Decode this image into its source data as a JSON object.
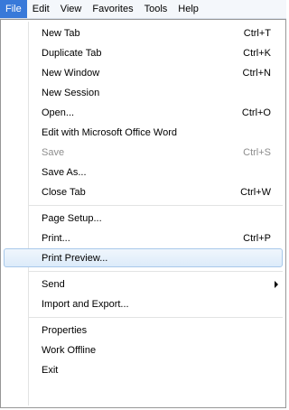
{
  "menubar": {
    "items": [
      {
        "label": "File",
        "active": true
      },
      {
        "label": "Edit"
      },
      {
        "label": "View"
      },
      {
        "label": "Favorites"
      },
      {
        "label": "Tools"
      },
      {
        "label": "Help"
      }
    ]
  },
  "menu": {
    "items": [
      {
        "label": "New Tab",
        "shortcut": "Ctrl+T"
      },
      {
        "label": "Duplicate Tab",
        "shortcut": "Ctrl+K"
      },
      {
        "label": "New Window",
        "shortcut": "Ctrl+N"
      },
      {
        "label": "New Session",
        "shortcut": ""
      },
      {
        "label": "Open...",
        "shortcut": "Ctrl+O"
      },
      {
        "label": "Edit with Microsoft Office Word",
        "shortcut": ""
      },
      {
        "label": "Save",
        "shortcut": "Ctrl+S",
        "disabled": true
      },
      {
        "label": "Save As...",
        "shortcut": ""
      },
      {
        "label": "Close Tab",
        "shortcut": "Ctrl+W"
      },
      {
        "label": "Page Setup...",
        "shortcut": ""
      },
      {
        "label": "Print...",
        "shortcut": "Ctrl+P"
      },
      {
        "label": "Print Preview...",
        "shortcut": "",
        "highlighted": true
      },
      {
        "label": "Send",
        "shortcut": "",
        "submenu": true
      },
      {
        "label": "Import and Export...",
        "shortcut": ""
      },
      {
        "label": "Properties",
        "shortcut": ""
      },
      {
        "label": "Work Offline",
        "shortcut": ""
      },
      {
        "label": "Exit",
        "shortcut": ""
      }
    ]
  },
  "colors": {
    "active_menubar_bg": "#3879d9",
    "hover_border": "#a8c8ea",
    "disabled_text": "#8d8d8d"
  }
}
